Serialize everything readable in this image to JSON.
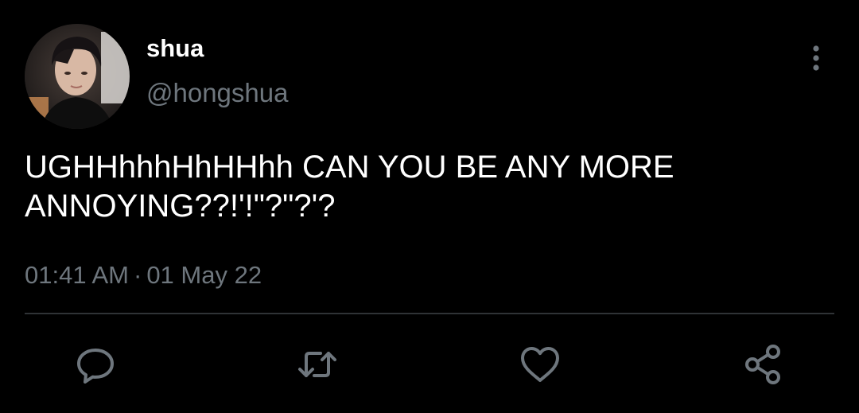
{
  "tweet": {
    "author_name": "shua",
    "author_handle": "@hongshua",
    "text_lines": [
      "UGHHhhhHhHHhh CAN YOU BE ANY MORE",
      "ANNOYING??!'!\"?\"?'?"
    ],
    "time": "01:41 AM",
    "separator": "·",
    "date": "01 May 22"
  },
  "actions": {
    "reply_icon": "reply-icon",
    "retweet_icon": "retweet-icon",
    "like_icon": "heart-icon",
    "share_icon": "share-icon",
    "more_icon": "more-vertical-icon"
  },
  "colors": {
    "background": "#000000",
    "text": "#ffffff",
    "secondary_text": "#6e767d",
    "divider": "#2f3336",
    "icon": "#6e767d"
  }
}
